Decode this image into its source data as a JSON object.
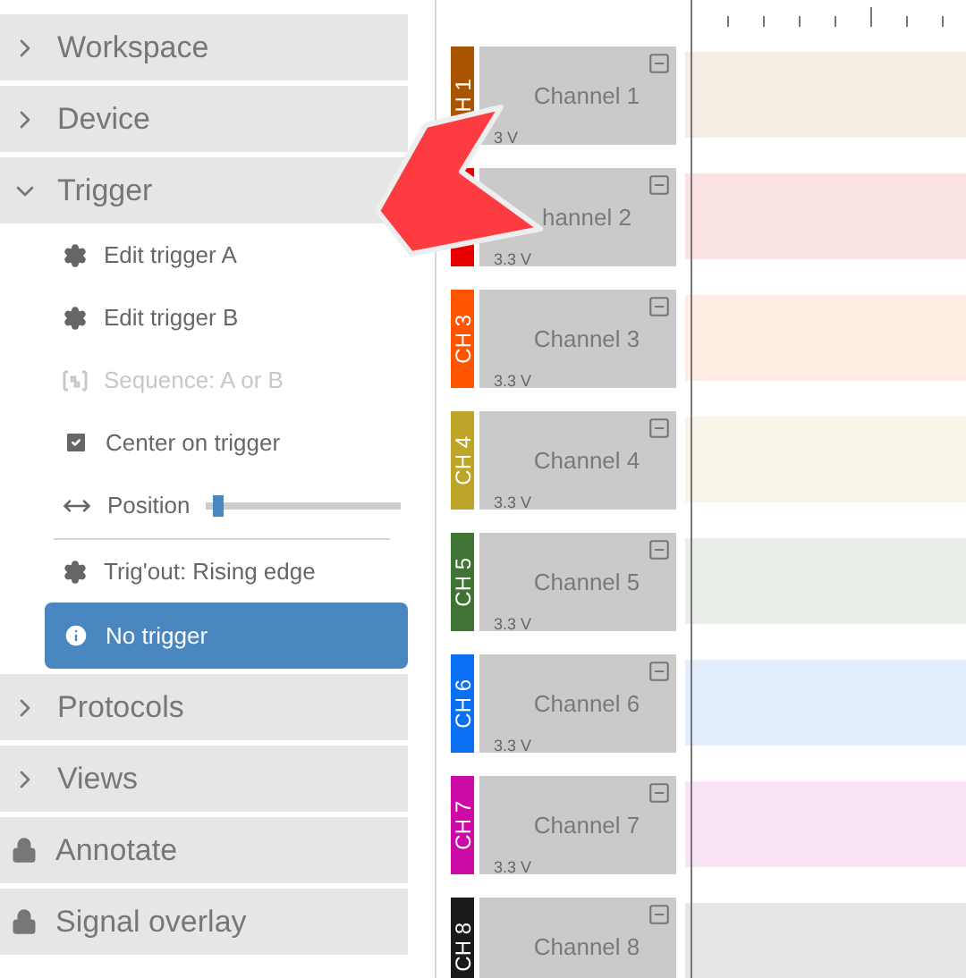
{
  "sidebar": {
    "sections": [
      {
        "title": "Workspace",
        "kind": "collapsible",
        "expanded": false
      },
      {
        "title": "Device",
        "kind": "collapsible",
        "expanded": false
      },
      {
        "title": "Trigger",
        "kind": "collapsible",
        "expanded": true,
        "items": [
          {
            "kind": "gear",
            "label": "Edit trigger A",
            "disabled": false
          },
          {
            "kind": "gear",
            "label": "Edit trigger B",
            "disabled": false
          },
          {
            "kind": "sequence",
            "label": "Sequence: A or B",
            "disabled": true
          },
          {
            "kind": "checkbox",
            "label": "Center on trigger",
            "checked": true,
            "disabled": false
          },
          {
            "kind": "slider",
            "label": "Position",
            "level": 0.03,
            "disabled": false
          },
          {
            "kind": "divider"
          },
          {
            "kind": "gear",
            "label": "Trig'out: Rising edge",
            "disabled": false
          },
          {
            "kind": "info",
            "label": "No trigger",
            "selected": true
          }
        ]
      },
      {
        "title": "Protocols",
        "kind": "collapsible",
        "expanded": false
      },
      {
        "title": "Views",
        "kind": "collapsible",
        "expanded": false
      },
      {
        "title": "Annotate",
        "kind": "locked"
      },
      {
        "title": "Signal overlay",
        "kind": "locked"
      }
    ]
  },
  "channels": [
    {
      "tag": "H 1",
      "name": "Channel 1",
      "voltage": "3 V",
      "color": "#a85400"
    },
    {
      "name": "hannel 2",
      "voltage": "3.3 V",
      "color": "#e80000"
    },
    {
      "tag": "CH 3",
      "name": "Channel 3",
      "voltage": "3.3 V",
      "color": "#ff5400"
    },
    {
      "tag": "CH 4",
      "name": "Channel 4",
      "voltage": "3.3 V",
      "color": "#bfa42a"
    },
    {
      "tag": "CH 5",
      "name": "Channel 5",
      "voltage": "3.3 V",
      "color": "#3f7434"
    },
    {
      "tag": "CH 6",
      "name": "Channel 6",
      "voltage": "3.3 V",
      "color": "#0a6ff0"
    },
    {
      "tag": "CH 7",
      "name": "Channel 7",
      "voltage": "3.3 V",
      "color": "#cc0ba6"
    },
    {
      "tag": "CH 8",
      "name": "Channel 8",
      "color": "#1a1a1a"
    }
  ]
}
